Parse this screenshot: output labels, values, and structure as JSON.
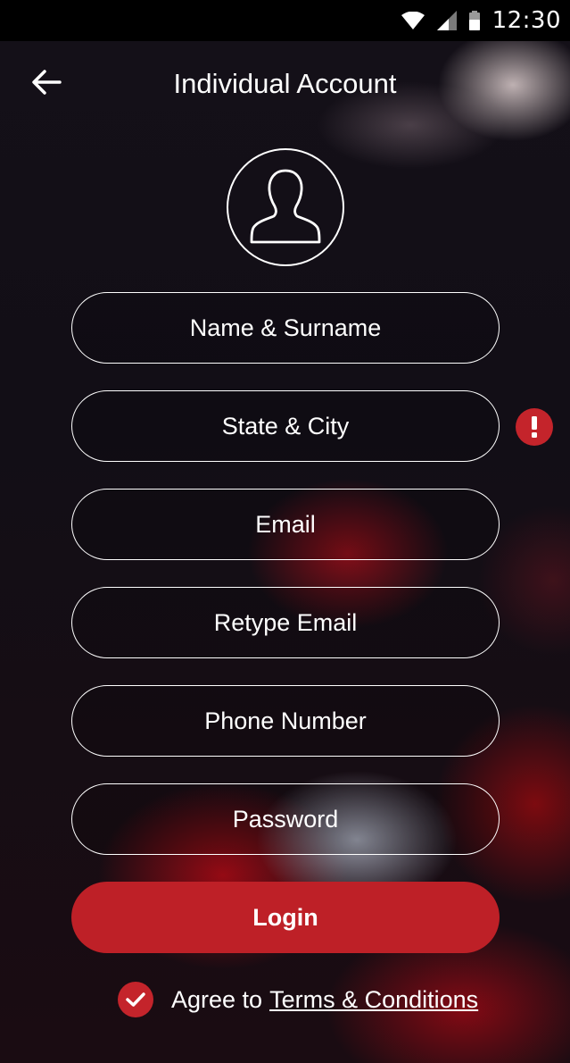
{
  "status_bar": {
    "time": "12:30",
    "icons": [
      "wifi-icon",
      "signal-icon",
      "battery-icon"
    ]
  },
  "header": {
    "back_icon": "arrow-left-icon",
    "title": "Individual Account"
  },
  "avatar": {
    "icon": "user-silhouette-icon"
  },
  "form": {
    "fields": [
      {
        "name": "name-surname",
        "placeholder": "Name & Surname"
      },
      {
        "name": "state-city",
        "placeholder": "State & City",
        "error": true
      },
      {
        "name": "email",
        "placeholder": "Email"
      },
      {
        "name": "retype-email",
        "placeholder": "Retype Email"
      },
      {
        "name": "phone-number",
        "placeholder": "Phone Number"
      },
      {
        "name": "password",
        "placeholder": "Password"
      }
    ],
    "error_icon": "exclamation-icon",
    "login_label": "Login"
  },
  "agreement": {
    "checked": true,
    "text": "Agree to",
    "link": "Terms & Conditions"
  },
  "colors": {
    "accent": "#be2027",
    "status_bar": "#000000",
    "text": "#ffffff"
  }
}
